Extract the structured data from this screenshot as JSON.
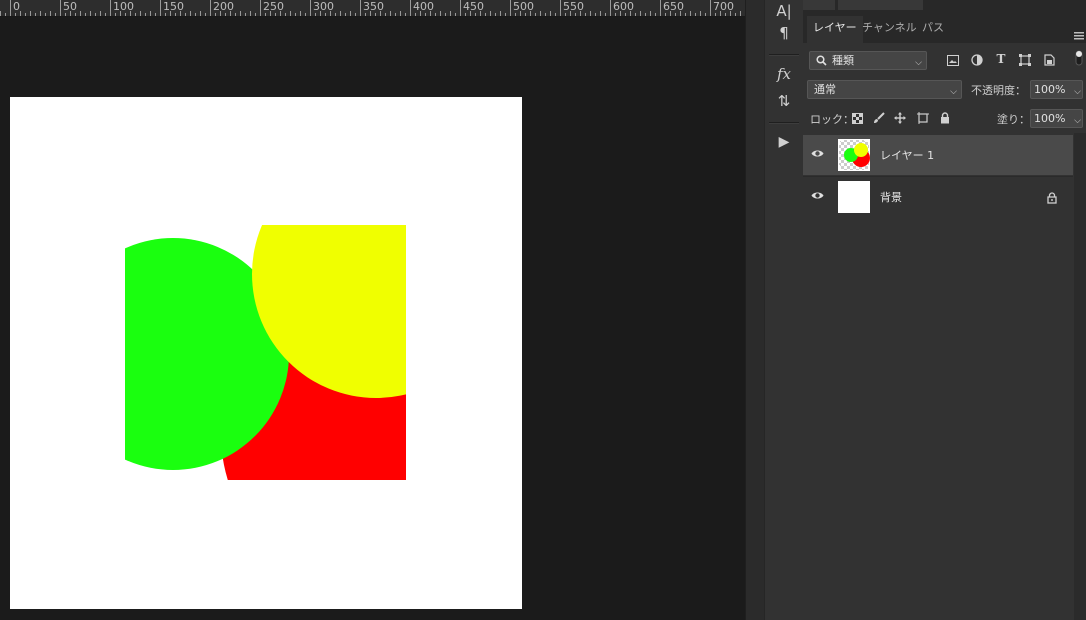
{
  "ruler": {
    "labels": [
      "0",
      "50",
      "100",
      "150",
      "200",
      "250",
      "300",
      "350",
      "400",
      "450",
      "500",
      "550",
      "600",
      "650",
      "700"
    ]
  },
  "canvas": {
    "colors": {
      "background": "#ffffff",
      "green": "#1aff0f",
      "yellow": "#f0ff00",
      "red": "#ff0000"
    }
  },
  "toolstrip": {
    "items": [
      {
        "name": "character-icon",
        "glyph": "A|"
      },
      {
        "name": "paragraph-icon",
        "glyph": "¶"
      },
      {
        "name": "fx-icon",
        "glyph": "fx"
      },
      {
        "name": "adjust-icon",
        "glyph": "⇅"
      },
      {
        "name": "play-icon",
        "glyph": "▶"
      }
    ]
  },
  "panel": {
    "tabs": [
      "レイヤー",
      "チャンネル",
      "パス"
    ],
    "active_tab": 0,
    "filter": {
      "label": "種類"
    },
    "blend_mode": "通常",
    "opacity_label": "不透明度：",
    "opacity_value": "100%",
    "lock_label": "ロック：",
    "fill_label": "塗り：",
    "fill_value": "100%",
    "layers": [
      {
        "name": "レイヤー 1",
        "selected": true,
        "visible": true,
        "locked": false
      },
      {
        "name": "背景",
        "selected": false,
        "visible": true,
        "locked": true
      }
    ]
  }
}
